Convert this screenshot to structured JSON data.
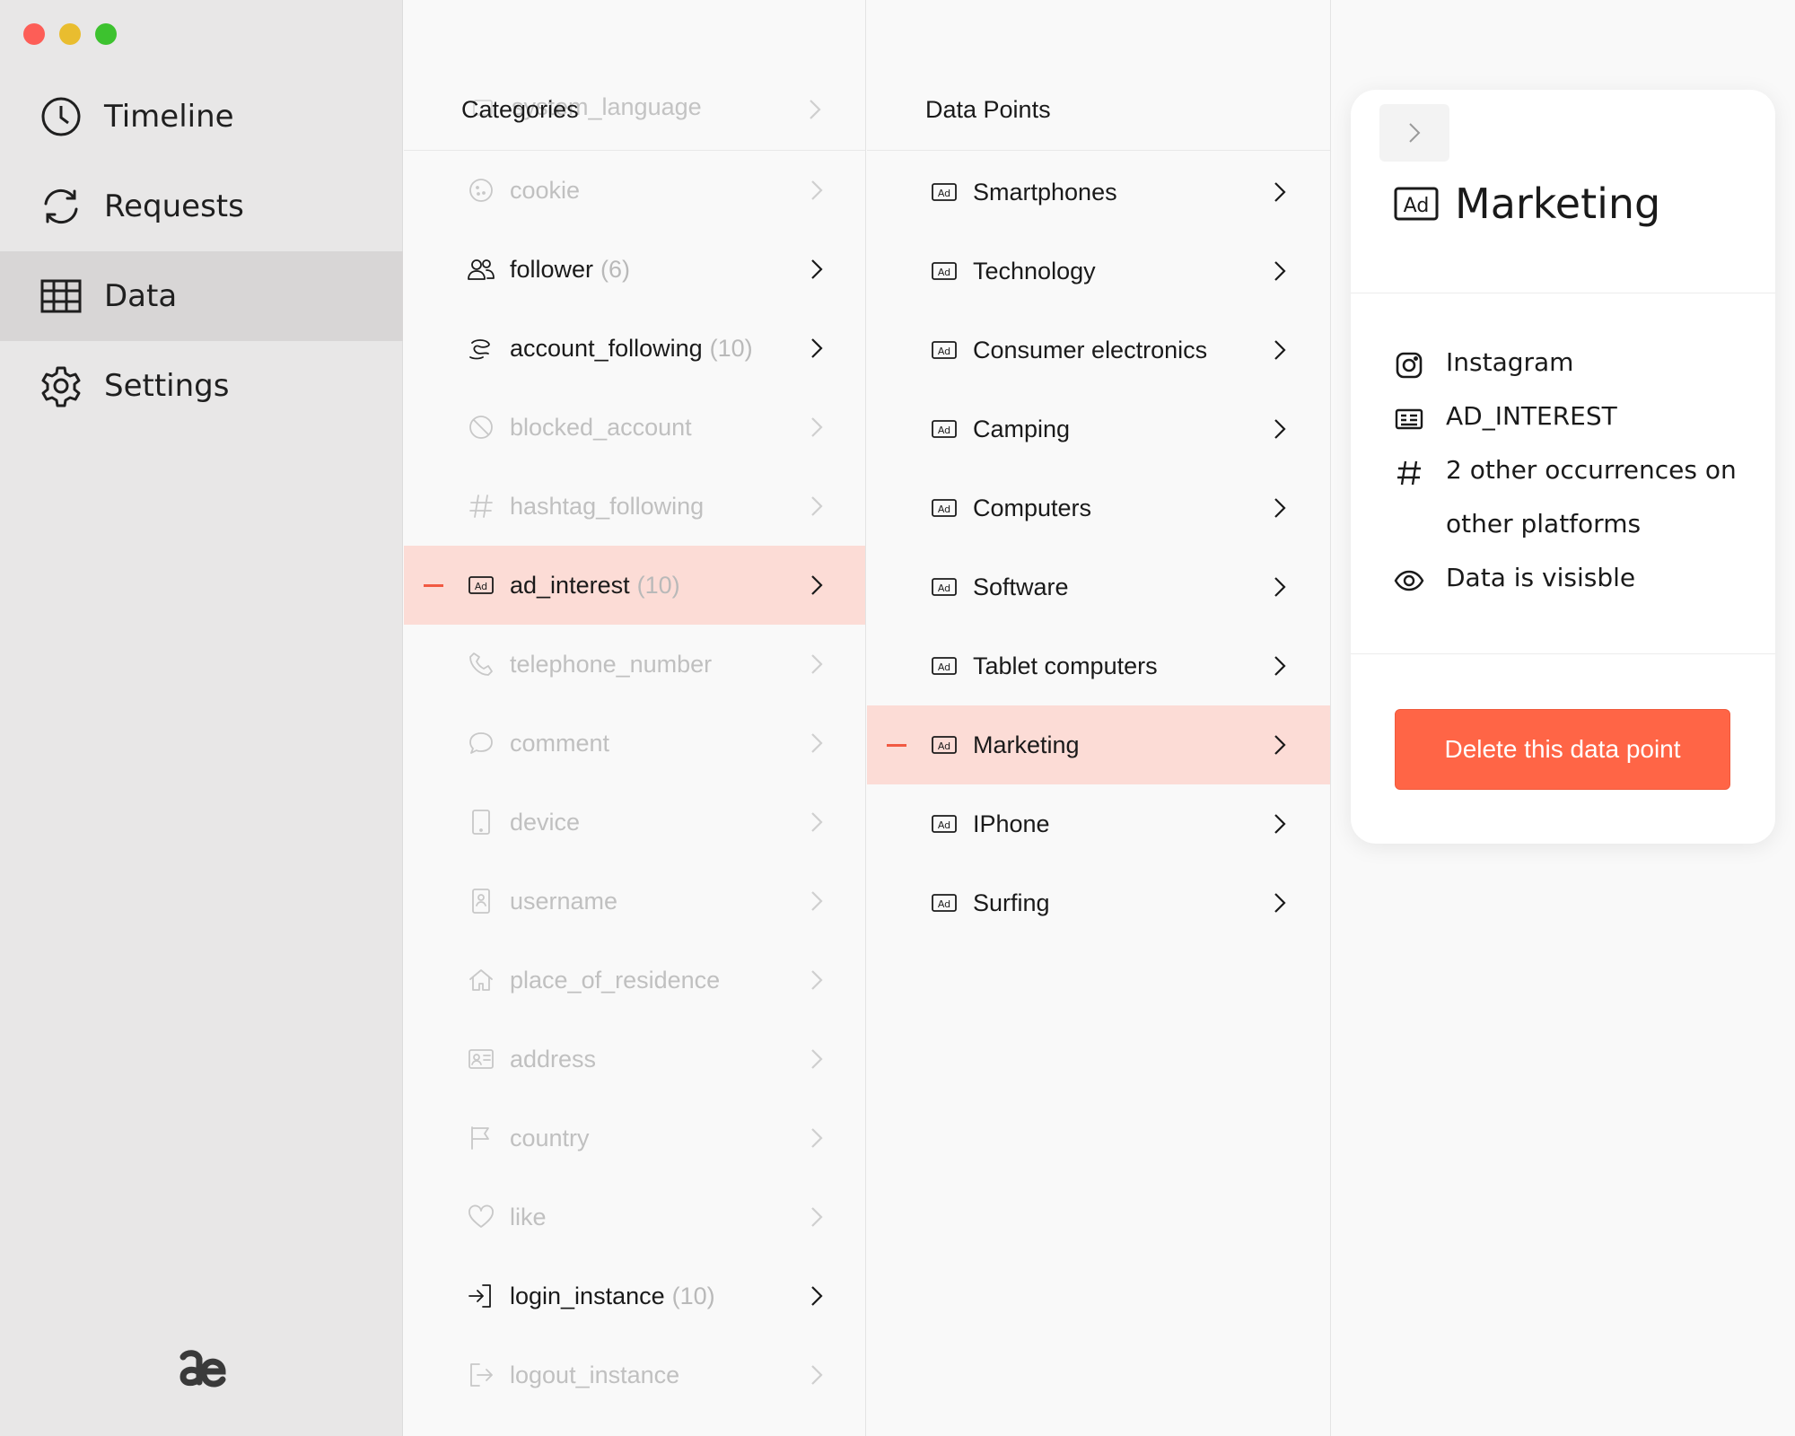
{
  "sidebar": {
    "items": [
      {
        "label": "Timeline",
        "icon": "clock-icon"
      },
      {
        "label": "Requests",
        "icon": "refresh-icon"
      },
      {
        "label": "Data",
        "icon": "table-icon",
        "active": true
      },
      {
        "label": "Settings",
        "icon": "gear-icon"
      }
    ]
  },
  "categories": {
    "title": "Categories",
    "ghost_label": "system_language",
    "items": [
      {
        "label": "cookie",
        "count": "",
        "icon": "cookie-icon",
        "dim": true
      },
      {
        "label": "follower",
        "count": "(6)",
        "icon": "users-icon",
        "dim": false
      },
      {
        "label": "account_following",
        "count": "(10)",
        "icon": "following-icon",
        "dim": false
      },
      {
        "label": "blocked_account",
        "count": "",
        "icon": "blocked-icon",
        "dim": true
      },
      {
        "label": "hashtag_following",
        "count": "",
        "icon": "hashtag-icon",
        "dim": true
      },
      {
        "label": "ad_interest",
        "count": "(10)",
        "icon": "ad-icon",
        "dim": false,
        "selected": true
      },
      {
        "label": "telephone_number",
        "count": "",
        "icon": "phone-icon",
        "dim": true
      },
      {
        "label": "comment",
        "count": "",
        "icon": "comment-icon",
        "dim": true
      },
      {
        "label": "device",
        "count": "",
        "icon": "device-icon",
        "dim": true
      },
      {
        "label": "username",
        "count": "",
        "icon": "username-icon",
        "dim": true
      },
      {
        "label": "place_of_residence",
        "count": "",
        "icon": "home-icon",
        "dim": true
      },
      {
        "label": "address",
        "count": "",
        "icon": "address-icon",
        "dim": true
      },
      {
        "label": "country",
        "count": "",
        "icon": "flag-icon",
        "dim": true
      },
      {
        "label": "like",
        "count": "",
        "icon": "heart-icon",
        "dim": true
      },
      {
        "label": "login_instance",
        "count": "(10)",
        "icon": "login-icon",
        "dim": false
      },
      {
        "label": "logout_instance",
        "count": "",
        "icon": "logout-icon",
        "dim": true
      }
    ]
  },
  "data_points": {
    "title": "Data Points",
    "items": [
      {
        "label": "Smartphones"
      },
      {
        "label": "Technology"
      },
      {
        "label": "Consumer electronics"
      },
      {
        "label": "Camping"
      },
      {
        "label": "Computers"
      },
      {
        "label": "Software"
      },
      {
        "label": "Tablet computers"
      },
      {
        "label": "Marketing",
        "selected": true
      },
      {
        "label": "IPhone"
      },
      {
        "label": "Surfing"
      }
    ]
  },
  "detail": {
    "title": "Marketing",
    "platform": "Instagram",
    "type": "AD_INTEREST",
    "occurrences": "2 other occurrences on other platforms",
    "visibility": "Data is visisble",
    "delete_label": "Delete this data point"
  },
  "colors": {
    "accent": "#ff6546",
    "selection": "#fcdcd6",
    "sidebar_bg": "#e8e7e7"
  }
}
